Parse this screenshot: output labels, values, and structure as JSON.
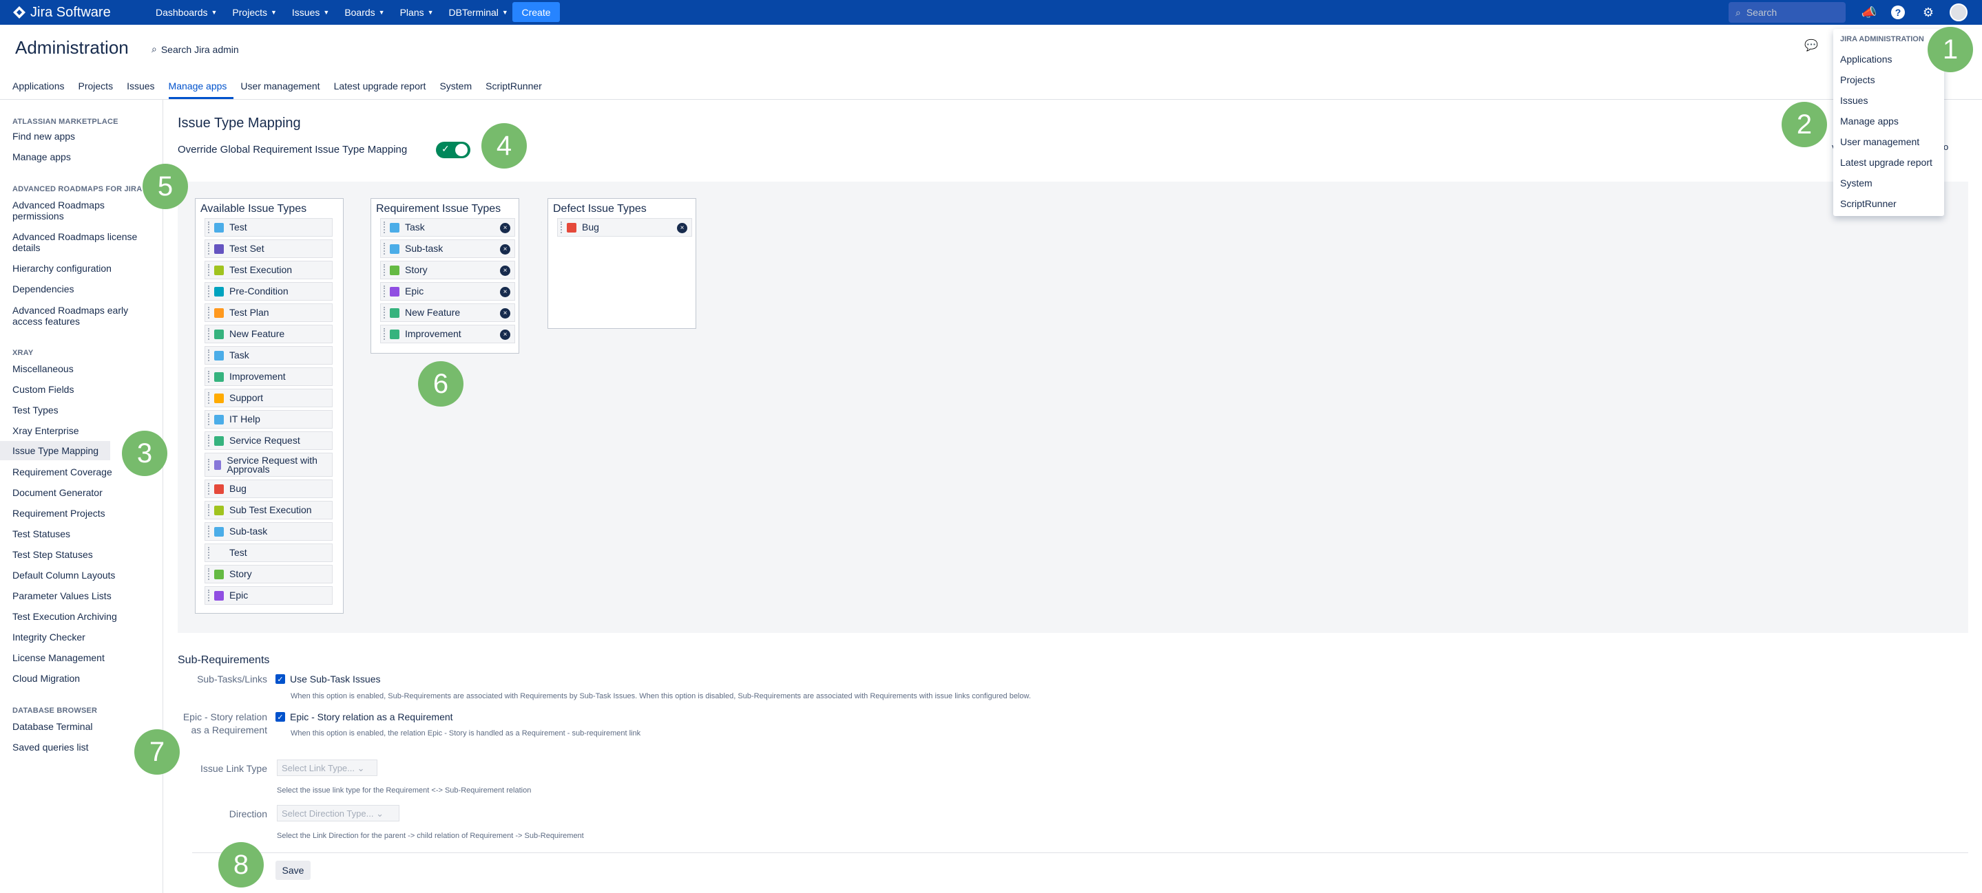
{
  "topbar": {
    "logo": "Jira Software",
    "nav": [
      "Dashboards",
      "Projects",
      "Issues",
      "Boards",
      "Plans",
      "DBTerminal"
    ],
    "create": "Create",
    "search_placeholder": "Search"
  },
  "admin": {
    "title": "Administration",
    "search": "Search Jira admin",
    "tabs": [
      "Applications",
      "Projects",
      "Issues",
      "Manage apps",
      "User management",
      "Latest upgrade report",
      "System",
      "ScriptRunner"
    ],
    "active_tab": "Manage apps"
  },
  "sidebar": {
    "sections": [
      {
        "heading": "ATLASSIAN MARKETPLACE",
        "items": [
          "Find new apps",
          "Manage apps"
        ]
      },
      {
        "heading": "ADVANCED ROADMAPS FOR JIRA",
        "items": [
          "Advanced Roadmaps permissions",
          "Advanced Roadmaps license details",
          "Hierarchy configuration",
          "Dependencies",
          "Advanced Roadmaps early access features"
        ]
      },
      {
        "heading": "XRAY",
        "items": [
          "Miscellaneous",
          "Custom Fields",
          "Test Types",
          "Xray Enterprise",
          "Issue Type Mapping",
          "Requirement Coverage",
          "Document Generator",
          "Requirement Projects",
          "Test Statuses",
          "Test Step Statuses",
          "Default Column Layouts",
          "Parameter Values Lists",
          "Test Execution Archiving",
          "Integrity Checker",
          "License Management",
          "Cloud Migration"
        ]
      },
      {
        "heading": "DATABASE BROWSER",
        "items": [
          "Database Terminal",
          "Saved queries list"
        ]
      }
    ],
    "selected": "Issue Type Mapping"
  },
  "main": {
    "title": "Issue Type Mapping",
    "override_label": "Override Global Requirement Issue Type Mapping",
    "override_on": true,
    "available": {
      "title": "Available Issue Types",
      "items": [
        {
          "label": "Test",
          "color": "#4bade8"
        },
        {
          "label": "Test Set",
          "color": "#6554c0"
        },
        {
          "label": "Test Execution",
          "color": "#a0c31f"
        },
        {
          "label": "Pre-Condition",
          "color": "#00a3bf"
        },
        {
          "label": "Test Plan",
          "color": "#ff991f"
        },
        {
          "label": "New Feature",
          "color": "#36b37e"
        },
        {
          "label": "Task",
          "color": "#4bade8"
        },
        {
          "label": "Improvement",
          "color": "#36b37e"
        },
        {
          "label": "Support",
          "color": "#ffab00"
        },
        {
          "label": "IT Help",
          "color": "#4bade8"
        },
        {
          "label": "Service Request",
          "color": "#36b37e"
        },
        {
          "label": "Service Request with Approvals",
          "color": "#8777d9"
        },
        {
          "label": "Bug",
          "color": "#e5493a"
        },
        {
          "label": "Sub Test Execution",
          "color": "#a0c31f"
        },
        {
          "label": "Sub-task",
          "color": "#4bade8"
        },
        {
          "label": "Test",
          "color": ""
        },
        {
          "label": "Story",
          "color": "#65ba43"
        },
        {
          "label": "Epic",
          "color": "#904ee2"
        }
      ]
    },
    "requirement": {
      "title": "Requirement Issue Types",
      "items": [
        {
          "label": "Task",
          "color": "#4bade8"
        },
        {
          "label": "Sub-task",
          "color": "#4bade8"
        },
        {
          "label": "Story",
          "color": "#65ba43"
        },
        {
          "label": "Epic",
          "color": "#904ee2"
        },
        {
          "label": "New Feature",
          "color": "#36b37e"
        },
        {
          "label": "Improvement",
          "color": "#36b37e"
        }
      ]
    },
    "defect": {
      "title": "Defect Issue Types",
      "items": [
        {
          "label": "Bug",
          "color": "#e5493a"
        }
      ]
    }
  },
  "subreq": {
    "title": "Sub-Requirements",
    "subtasks_label": "Sub-Tasks/Links",
    "use_subtasks": "Use Sub-Task Issues",
    "use_subtasks_help": "When this option is enabled, Sub-Requirements are associated with Requirements by Sub-Task Issues. When this option is disabled, Sub-Requirements are associated with Requirements with issue links configured below.",
    "epic_label": "Epic - Story relation as a Requirement",
    "epic_value": "Epic - Story relation as a Requirement",
    "epic_help": "When this option is enabled, the relation Epic - Story is handled as a Requirement - sub-requirement link",
    "link_label": "Issue Link Type",
    "link_placeholder": "Select Link Type...",
    "link_help": "Select the issue link type for the Requirement <-> Sub-Requirement relation",
    "dir_label": "Direction",
    "dir_placeholder": "Select Direction Type...",
    "dir_help": "Select the Link Direction for the parent -> child relation of Requirement -> Sub-Requirement",
    "save": "Save"
  },
  "dropdown": {
    "heading": "JIRA ADMINISTRATION",
    "items": [
      "Applications",
      "Projects",
      "Issues",
      "Manage apps",
      "User management",
      "Latest upgrade report",
      "System",
      "ScriptRunner"
    ]
  },
  "badges": [
    "1",
    "2",
    "3",
    "4",
    "5",
    "6",
    "7",
    "8"
  ],
  "partial_text": {
    "a": "v",
    "b": "o"
  }
}
